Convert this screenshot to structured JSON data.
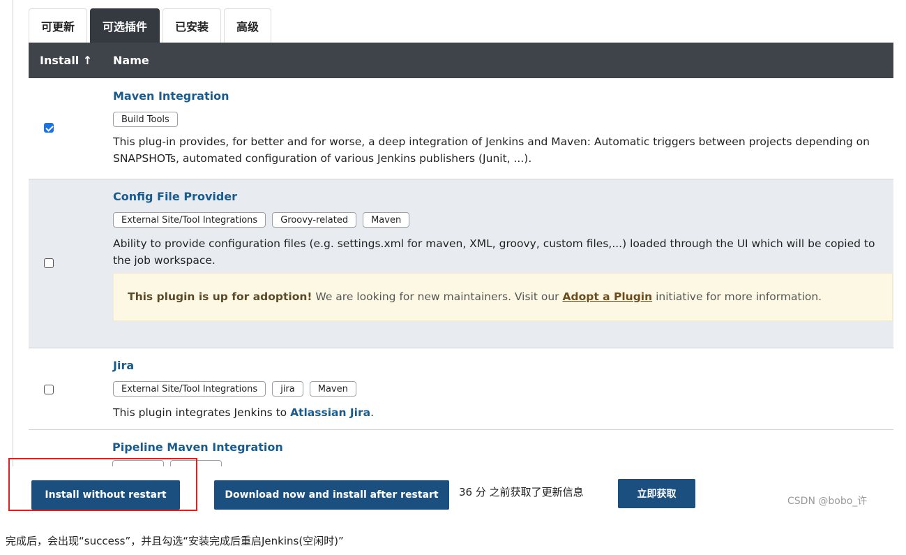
{
  "tabs": [
    {
      "label": "可更新",
      "active": false
    },
    {
      "label": "可选插件",
      "active": true
    },
    {
      "label": "已安装",
      "active": false
    },
    {
      "label": "高级",
      "active": false
    }
  ],
  "table": {
    "col_install": "Install ↑",
    "col_name": "Name"
  },
  "plugins": [
    {
      "name": "Maven Integration",
      "checked": true,
      "tags": [
        "Build Tools"
      ],
      "description": "This plug-in provides, for better and for worse, a deep integration of Jenkins and Maven: Automatic triggers between projects depending on SNAPSHOTs, automated configuration of various Jenkins publishers (Junit, ...)."
    },
    {
      "name": "Config File Provider",
      "checked": false,
      "tags": [
        "External Site/Tool Integrations",
        "Groovy-related",
        "Maven"
      ],
      "description": "Ability to provide configuration files (e.g. settings.xml for maven, XML, groovy, custom files,...) loaded through the UI which will be copied to the job workspace.",
      "adoption": {
        "bold": "This plugin is up for adoption!",
        "text_before_link": " We are looking for new maintainers. Visit our ",
        "link": "Adopt a Plugin",
        "text_after_link": " initiative for more information."
      }
    },
    {
      "name": "Jira",
      "checked": false,
      "tags": [
        "External Site/Tool Integrations",
        "jira",
        "Maven"
      ],
      "description_prefix": "This plugin integrates Jenkins to ",
      "description_link": "Atlassian Jira",
      "description_suffix": "."
    },
    {
      "name": "Pipeline Maven Integration",
      "checked": false
    }
  ],
  "actions": {
    "install_without_restart": "Install without restart",
    "download_install_after_restart": "Download now and install after restart",
    "update_info": "36 分 之前获取了更新信息",
    "fetch_now": "立即获取"
  },
  "watermark": "CSDN @bobo_许",
  "note": "完成后，会出现“success”，并且勾选“安装完成后重启Jenkins(空闲时)”",
  "colors": {
    "header_bg": "#3e4449",
    "button_bg": "#1a4f80",
    "link": "#1a5b8e",
    "highlight_border": "#e0201e",
    "checkbox_checked": "#1a73e8"
  }
}
